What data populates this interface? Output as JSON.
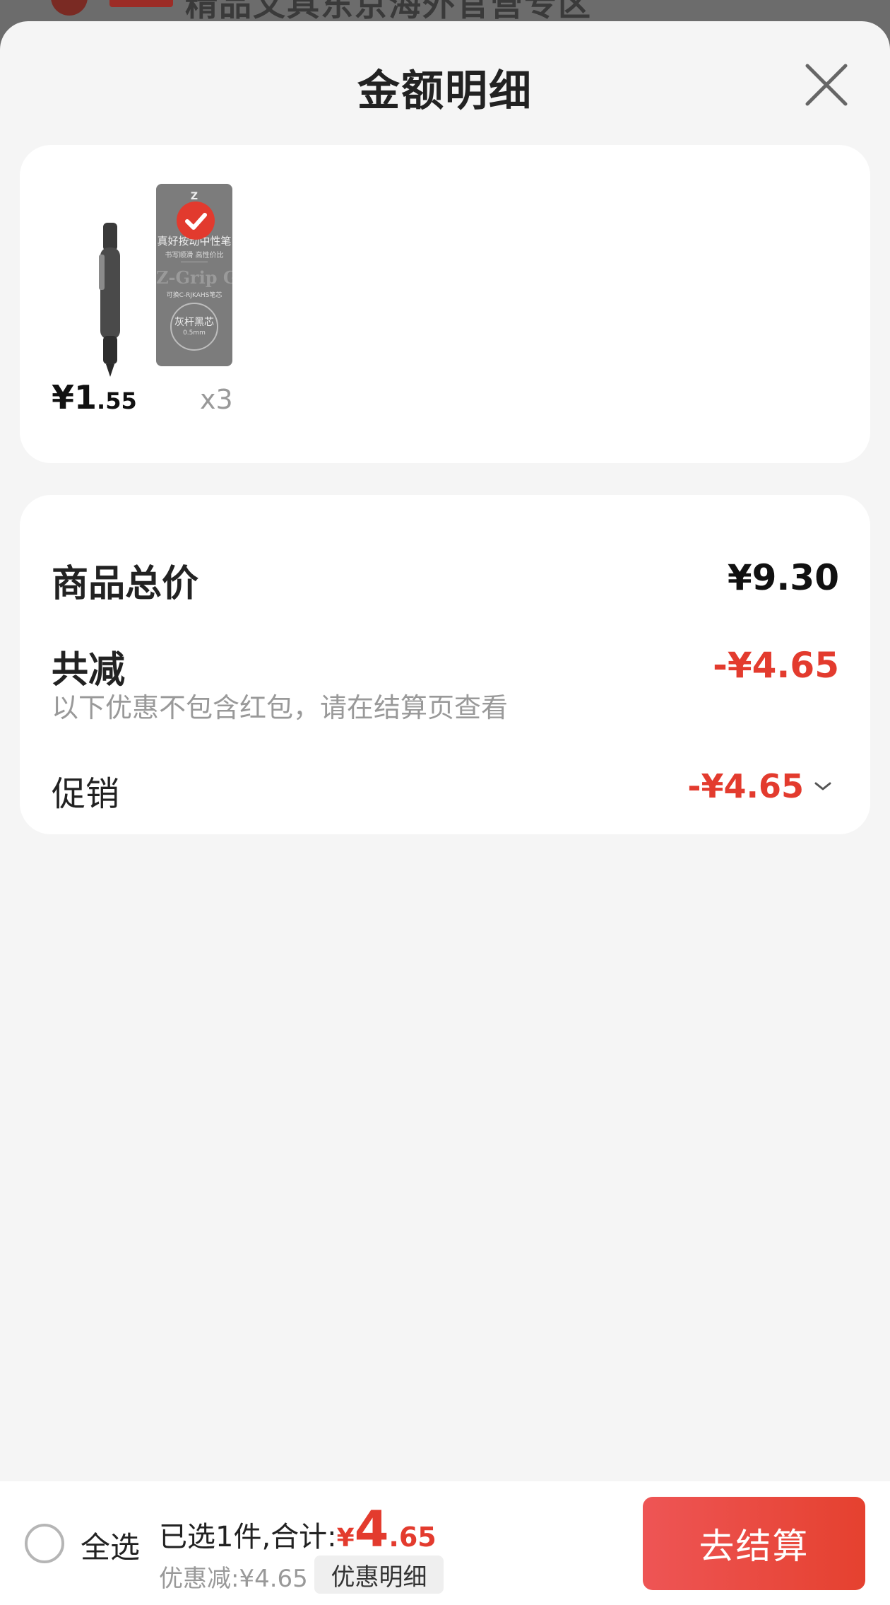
{
  "background": {
    "store_name": "精品文具东京海外官营专区"
  },
  "sheet": {
    "title": "金额明细",
    "close_icon": "close-icon"
  },
  "products": {
    "pack_brand": "Z",
    "pack_title": "真好按动中性笔",
    "pack_sub": "书写顺滑 高性价比",
    "pack_grip": "Z-Grip Gel",
    "pack_refill": "可换C-RJKAHS笔芯",
    "pack_color": "灰杆黑芯",
    "pack_size": "0.5mm",
    "price_currency": "¥",
    "price_int": "1",
    "price_dec": ".55",
    "quantity": "x3"
  },
  "summary": {
    "total_label": "商品总价",
    "total_value": "¥9.30",
    "reduce_label": "共减",
    "reduce_value": "-¥4.65",
    "note": "以下优惠不包含红包，请在结算页查看",
    "promo_label": "促销",
    "promo_value": "-¥4.65"
  },
  "bottom_bar": {
    "select_all": "全选",
    "selected_text": "已选1件,合计:",
    "currency": "¥",
    "amount_int": "4",
    "amount_dec": ".65",
    "discount_text": "优惠减:¥4.65",
    "detail_button": "优惠明细",
    "checkout_button": "去结算"
  },
  "colors": {
    "accent_red": "#e33b2e",
    "checkout_gradient_start": "#ee5555",
    "checkout_gradient_end": "#e5412f"
  }
}
